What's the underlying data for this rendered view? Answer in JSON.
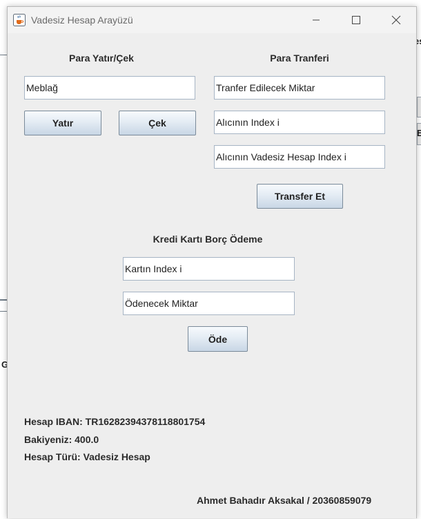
{
  "window": {
    "title": "Vadesiz Hesap Arayüzü",
    "icon": "java-cup-icon",
    "controls": [
      "minimize-icon",
      "maximize-icon",
      "close-icon"
    ]
  },
  "background_fragments": {
    "right_top_text": "es",
    "right_mid_text": "E",
    "left_mid_text": "G"
  },
  "deposit_withdraw": {
    "heading": "Para Yatır/Çek",
    "amount_value": "Meblağ",
    "deposit_label": "Yatır",
    "withdraw_label": "Çek"
  },
  "transfer": {
    "heading": "Para Tranferi",
    "amount_value": "Tranfer Edilecek Miktar",
    "recipient_index_value": "Alıcının Index i",
    "recipient_account_index_value": "Alıcının Vadesiz Hesap Index i",
    "transfer_label": "Transfer Et"
  },
  "credit_card": {
    "heading": "Kredi Kartı Borç Ödeme",
    "card_index_value": "Kartın Index i",
    "payment_amount_value": "Ödenecek Miktar",
    "pay_label": "Öde"
  },
  "account_info": {
    "iban": "Hesap IBAN: TR16282394378118801754",
    "balance": "Bakiyeniz: 400.0",
    "type": "Hesap Türü: Vadesiz Hesap"
  },
  "footer": {
    "author": "Ahmet Bahadır Aksakal / 20360859079"
  },
  "colors": {
    "window_bg": "#eeeeee",
    "field_border": "#a6b4c4",
    "button_gradient_top": "#f7fafd",
    "button_gradient_bottom": "#c8d6e5"
  }
}
